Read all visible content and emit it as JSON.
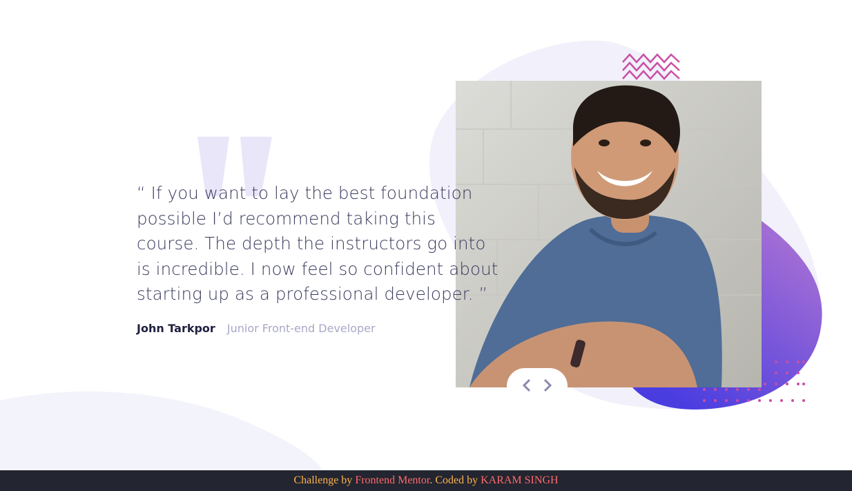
{
  "testimonial": {
    "quote": "“ If you want to lay the best foundation possible I’d recommend taking this course. The depth the instructors go into is incredible. I now feel so confident about starting up as a professional developer. ”",
    "author_name": "John Tarkpor",
    "author_role": "Junior Front-end Developer"
  },
  "photo": {
    "alt": "John Tarkpor"
  },
  "navigation": {
    "prev_icon": "chevron-left-icon",
    "next_icon": "chevron-right-icon"
  },
  "footer": {
    "prefix": "Challenge by ",
    "challenge_link": "Frontend Mentor",
    "middle": ". Coded by ",
    "author_link": "KARAM SINGH"
  },
  "colors": {
    "background": "#ffffff",
    "text": "#3a3a5e",
    "muted": "#a8a8c8",
    "accent_gradient_start": "#4a3de0",
    "accent_gradient_end": "#9460d6",
    "pattern": "#c94fa4",
    "footer_bg": "#232530"
  }
}
